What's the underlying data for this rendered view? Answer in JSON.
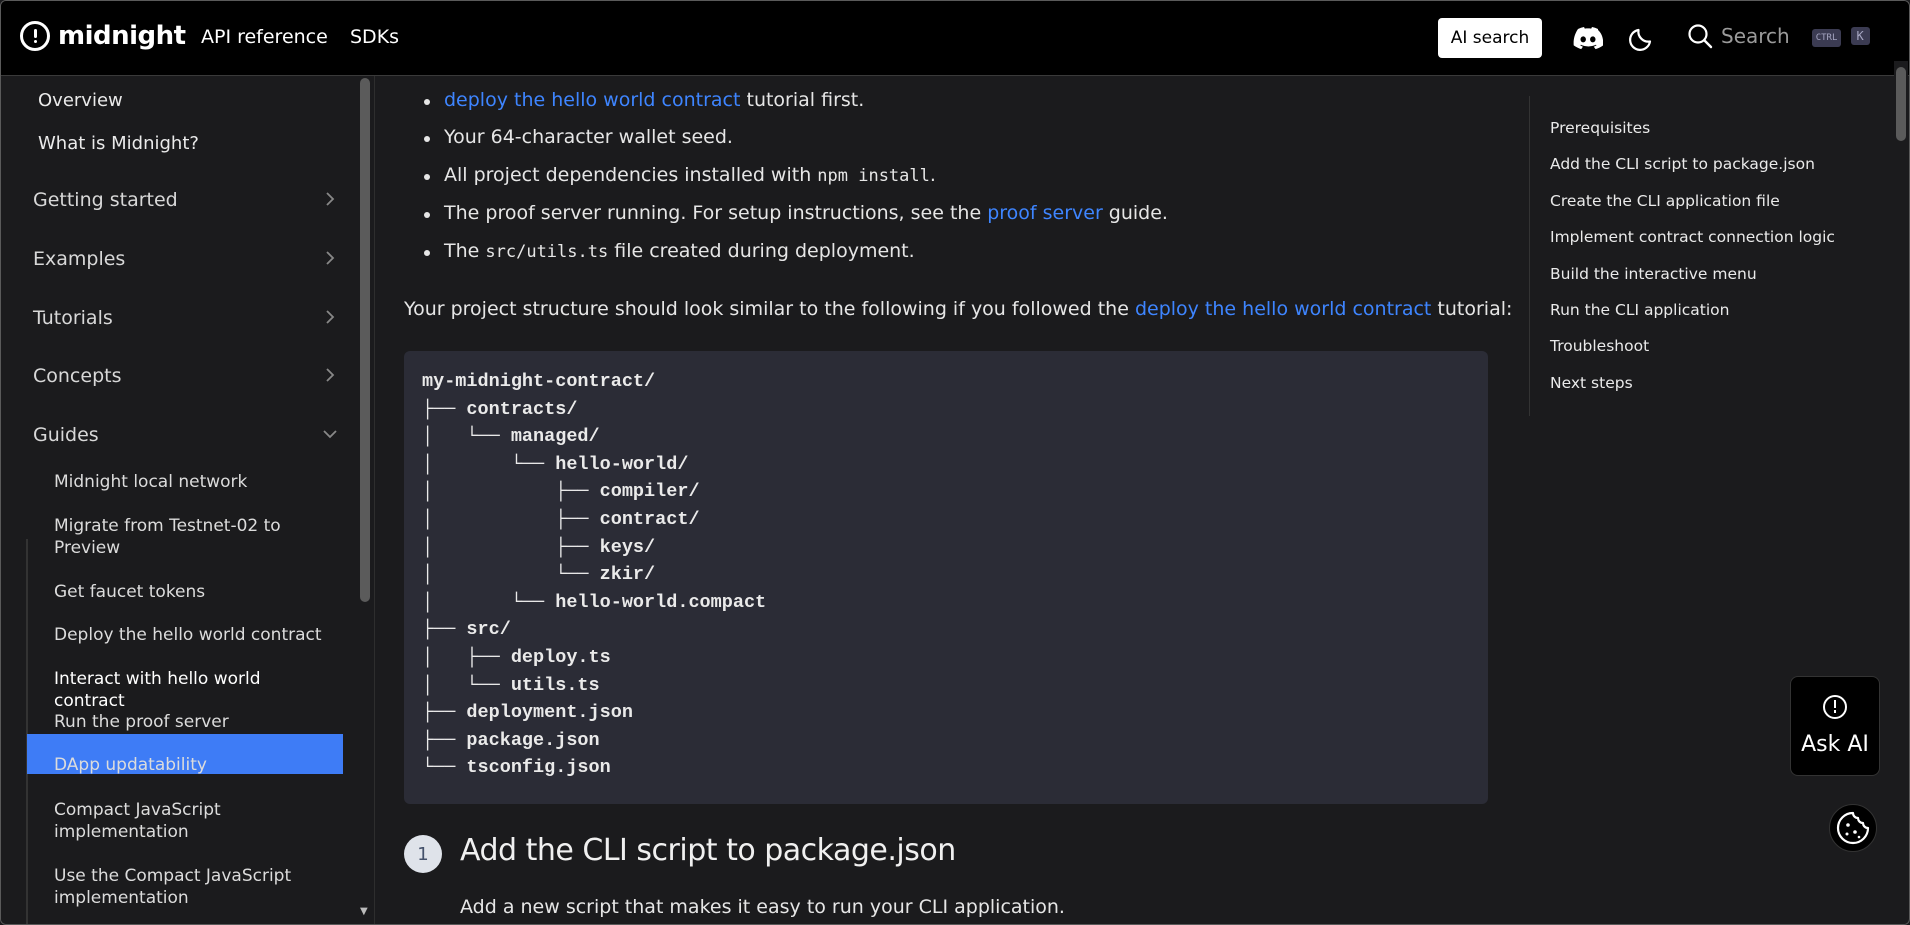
{
  "navbar": {
    "brand": "midnight",
    "links": [
      "API reference",
      "SDKs"
    ],
    "ai_search": "AI search",
    "search_label": "Search",
    "kbd_ctrl": "CTRL",
    "kbd_k": "K"
  },
  "sidebar": {
    "top_items": [
      "Overview",
      "What is Midnight?"
    ],
    "categories": [
      "Getting started",
      "Examples",
      "Tutorials",
      "Concepts",
      "Guides"
    ],
    "guides": [
      "Midnight local network",
      "Migrate from Testnet-02 to Preview",
      "Get faucet tokens",
      "Deploy the hello world contract",
      "Interact with hello world contract",
      "Run the proof server",
      "DApp updatability",
      "Compact JavaScript implementation",
      "Use the Compact JavaScript implementation"
    ]
  },
  "content": {
    "partial_line_link": "deploy the hello world contract",
    "partial_line_rest": " tutorial first.",
    "bullets": {
      "b1": "Your 64-character wallet seed.",
      "b2_pre": "All project dependencies installed with ",
      "b2_code": "npm install",
      "b2_post": ".",
      "b3_pre": "The proof server running. For setup instructions, see the ",
      "b3_link": "proof server",
      "b3_post": " guide.",
      "b4_pre": "The ",
      "b4_code": "src/utils.ts",
      "b4_post": " file created during deployment."
    },
    "para_pre": "Your project structure should look similar to the following if you followed the ",
    "para_link": "deploy the hello world contract",
    "para_post": " tutorial:",
    "code": "my-midnight-contract/\n├── contracts/\n│   └── managed/\n│       └── hello-world/\n│           ├── compiler/\n│           ├── contract/\n│           ├── keys/\n│           └── zkir/\n│       └── hello-world.compact\n├── src/\n│   ├── deploy.ts\n│   └── utils.ts\n├── deployment.json\n├── package.json\n└── tsconfig.json",
    "step_number": "1",
    "step_title": "Add the CLI script to package.json",
    "step_text": "Add a new script that makes it easy to run your CLI application."
  },
  "toc": [
    "Prerequisites",
    "Add the CLI script to package.json",
    "Create the CLI application file",
    "Implement contract connection logic",
    "Build the interactive menu",
    "Run the CLI application",
    "Troubleshoot",
    "Next steps"
  ],
  "ask_ai": "Ask AI",
  "colors": {
    "accent": "#3e7cf6",
    "link": "#3e85ff",
    "code_bg": "#2b2c36"
  }
}
